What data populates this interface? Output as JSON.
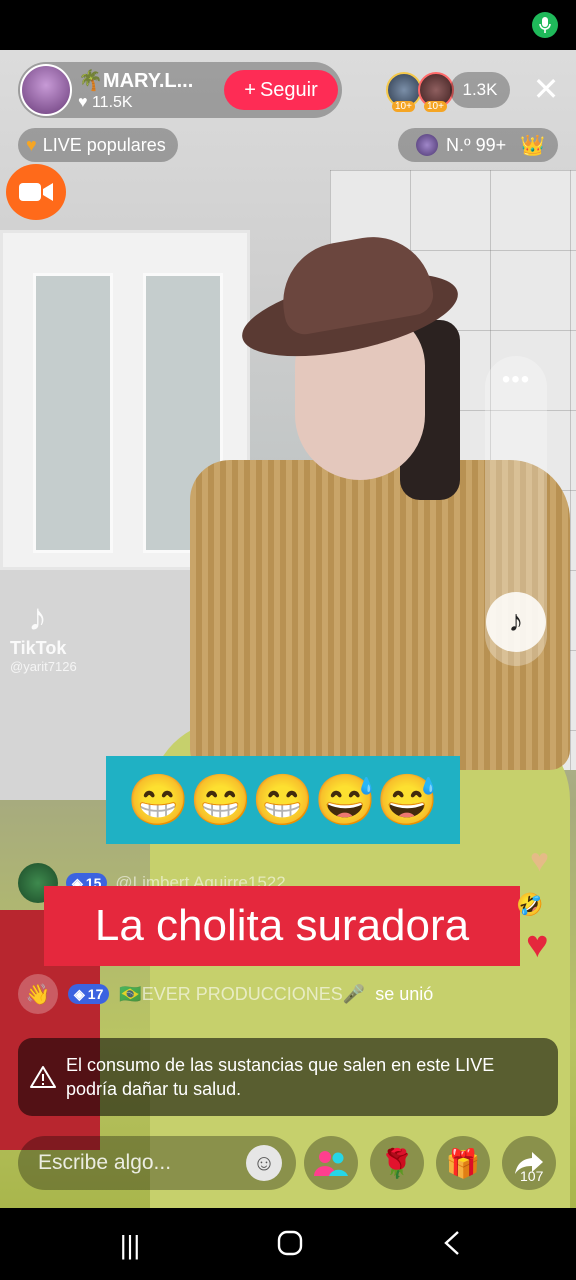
{
  "host": {
    "name": "🌴MARY.L...",
    "likes": "11.5K",
    "follow_label": "Seguir"
  },
  "viewers": {
    "badge_1": "10+",
    "badge_2": "10+",
    "count": "1.3K"
  },
  "popular": {
    "label": "LIVE populares"
  },
  "rank": {
    "label": "N.º 99+"
  },
  "watermark": {
    "brand": "TikTok",
    "handle": "@yarit7126"
  },
  "emoji_banner": {
    "text": "😁😁😁😅😅"
  },
  "comment": {
    "level": "15",
    "username": "@Limbert Aguirre1522"
  },
  "caption": {
    "text": "La cholita suradora"
  },
  "joined": {
    "level": "17",
    "username": "🇧🇷EVER PRODUCCIONES🎤",
    "action": "se unió"
  },
  "warning": {
    "text": "El consumo de las sustancias que salen en este LIVE podría dañar tu salud."
  },
  "input": {
    "placeholder": "Escribe algo..."
  },
  "share": {
    "count": "107"
  },
  "colors": {
    "follow": "#fe2c55",
    "caption_bg": "#e5283d",
    "emoji_banner_bg": "#1fb1c4",
    "live_cam": "#ff6a1a",
    "level_badge": "#3c63e0"
  },
  "icons": {
    "mic": "mic-icon",
    "close": "close-icon",
    "more": "more-icon",
    "music": "music-note-icon",
    "wave": "wave-hand-icon",
    "warning": "warning-triangle-icon",
    "emoji": "smiley-icon",
    "guests": "guests-icon",
    "rose": "rose-icon",
    "gift": "gift-icon",
    "share": "share-icon"
  }
}
